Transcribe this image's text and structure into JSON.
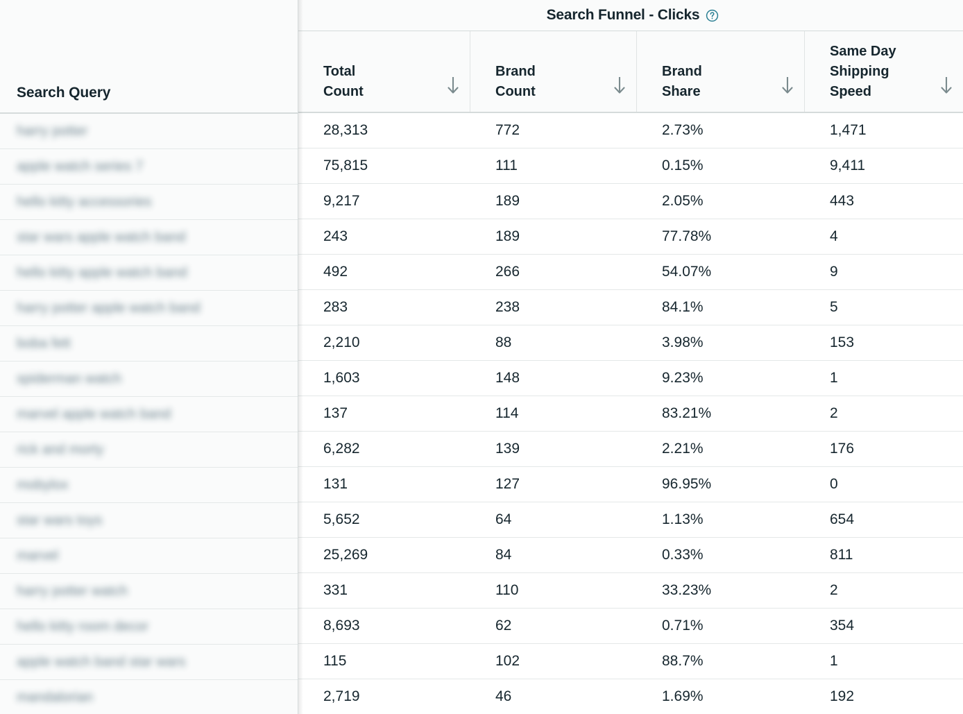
{
  "table": {
    "title": "Search Funnel - Clicks",
    "help_icon": "help-circle-icon",
    "frozen_column": {
      "header": "Search Query",
      "redacted": true
    },
    "columns": [
      {
        "label": "Total\nCount",
        "sort_icon": "arrow-down-icon"
      },
      {
        "label": "Brand\nCount",
        "sort_icon": "arrow-down-icon"
      },
      {
        "label": "Brand\nShare",
        "sort_icon": "arrow-down-icon"
      },
      {
        "label": "Same Day\nShipping\nSpeed",
        "sort_icon": "arrow-down-icon"
      }
    ],
    "rows": [
      {
        "query": "harry potter",
        "total_count": "28,313",
        "brand_count": "772",
        "brand_share": "2.73%",
        "same_day_shipping_speed": "1,471"
      },
      {
        "query": "apple watch series 7",
        "total_count": "75,815",
        "brand_count": "111",
        "brand_share": "0.15%",
        "same_day_shipping_speed": "9,411"
      },
      {
        "query": "hello kitty accessories",
        "total_count": "9,217",
        "brand_count": "189",
        "brand_share": "2.05%",
        "same_day_shipping_speed": "443"
      },
      {
        "query": "star wars apple watch band",
        "total_count": "243",
        "brand_count": "189",
        "brand_share": "77.78%",
        "same_day_shipping_speed": "4"
      },
      {
        "query": "hello kitty apple watch band",
        "total_count": "492",
        "brand_count": "266",
        "brand_share": "54.07%",
        "same_day_shipping_speed": "9"
      },
      {
        "query": "harry potter apple watch band",
        "total_count": "283",
        "brand_count": "238",
        "brand_share": "84.1%",
        "same_day_shipping_speed": "5"
      },
      {
        "query": "boba fett",
        "total_count": "2,210",
        "brand_count": "88",
        "brand_share": "3.98%",
        "same_day_shipping_speed": "153"
      },
      {
        "query": "spiderman watch",
        "total_count": "1,603",
        "brand_count": "148",
        "brand_share": "9.23%",
        "same_day_shipping_speed": "1"
      },
      {
        "query": "marvel apple watch band",
        "total_count": "137",
        "brand_count": "114",
        "brand_share": "83.21%",
        "same_day_shipping_speed": "2"
      },
      {
        "query": "rick and morty",
        "total_count": "6,282",
        "brand_count": "139",
        "brand_share": "2.21%",
        "same_day_shipping_speed": "176"
      },
      {
        "query": "mobylox",
        "total_count": "131",
        "brand_count": "127",
        "brand_share": "96.95%",
        "same_day_shipping_speed": "0"
      },
      {
        "query": "star wars toys",
        "total_count": "5,652",
        "brand_count": "64",
        "brand_share": "1.13%",
        "same_day_shipping_speed": "654"
      },
      {
        "query": "marvel",
        "total_count": "25,269",
        "brand_count": "84",
        "brand_share": "0.33%",
        "same_day_shipping_speed": "811"
      },
      {
        "query": "harry potter watch",
        "total_count": "331",
        "brand_count": "110",
        "brand_share": "33.23%",
        "same_day_shipping_speed": "2"
      },
      {
        "query": "hello kitty room decor",
        "total_count": "8,693",
        "brand_count": "62",
        "brand_share": "0.71%",
        "same_day_shipping_speed": "354"
      },
      {
        "query": "apple watch band star wars",
        "total_count": "115",
        "brand_count": "102",
        "brand_share": "88.7%",
        "same_day_shipping_speed": "1"
      },
      {
        "query": "mandalorian",
        "total_count": "2,719",
        "brand_count": "46",
        "brand_share": "1.69%",
        "same_day_shipping_speed": "192"
      }
    ]
  },
  "colors": {
    "text": "#16262e",
    "help_icon": "#2a7f93",
    "sort_arrow": "#7b8b8e",
    "border": "#d5dbdb",
    "row_border": "#e4e8e8",
    "header_bg": "#fafbfb",
    "body_bg": "#ffffff"
  }
}
